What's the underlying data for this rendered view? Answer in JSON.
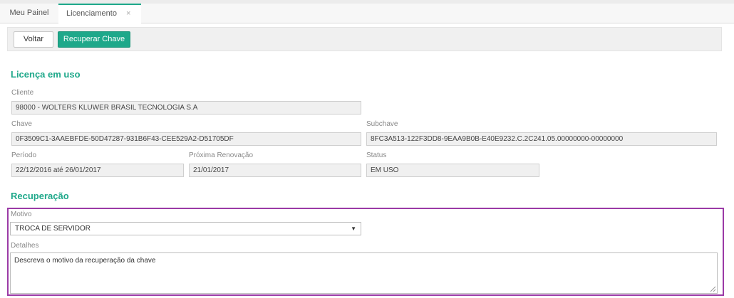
{
  "tabs": [
    {
      "label": "Meu Painel"
    },
    {
      "label": "Licenciamento",
      "close": "×"
    }
  ],
  "toolbar": {
    "back_label": "Voltar",
    "recover_label": "Recuperar Chave"
  },
  "license": {
    "title": "Licença em uso",
    "client_label": "Cliente",
    "client_value": "98000 - WOLTERS KLUWER BRASIL TECNOLOGIA S.A",
    "key_label": "Chave",
    "key_value": "0F3509C1-3AAEBFDE-50D47287-931B6F43-CEE529A2-D51705DF",
    "subkey_label": "Subchave",
    "subkey_value": "8FC3A513-122F3DD8-9EAA9B0B-E40E9232.C.2C241.05.00000000-00000000",
    "period_label": "Período",
    "period_value": "22/12/2016 até 26/01/2017",
    "renewal_label": "Próxima Renovação",
    "renewal_value": "21/01/2017",
    "status_label": "Status",
    "status_value": "EM USO"
  },
  "recovery": {
    "title": "Recuperação",
    "reason_label": "Motivo",
    "reason_value": "TROCA DE SERVIDOR",
    "details_label": "Detalhes",
    "details_placeholder": "Descreva o motivo da recuperação da chave"
  },
  "colors": {
    "accent": "#1ea88a",
    "highlight_border": "#9b3aa6"
  }
}
